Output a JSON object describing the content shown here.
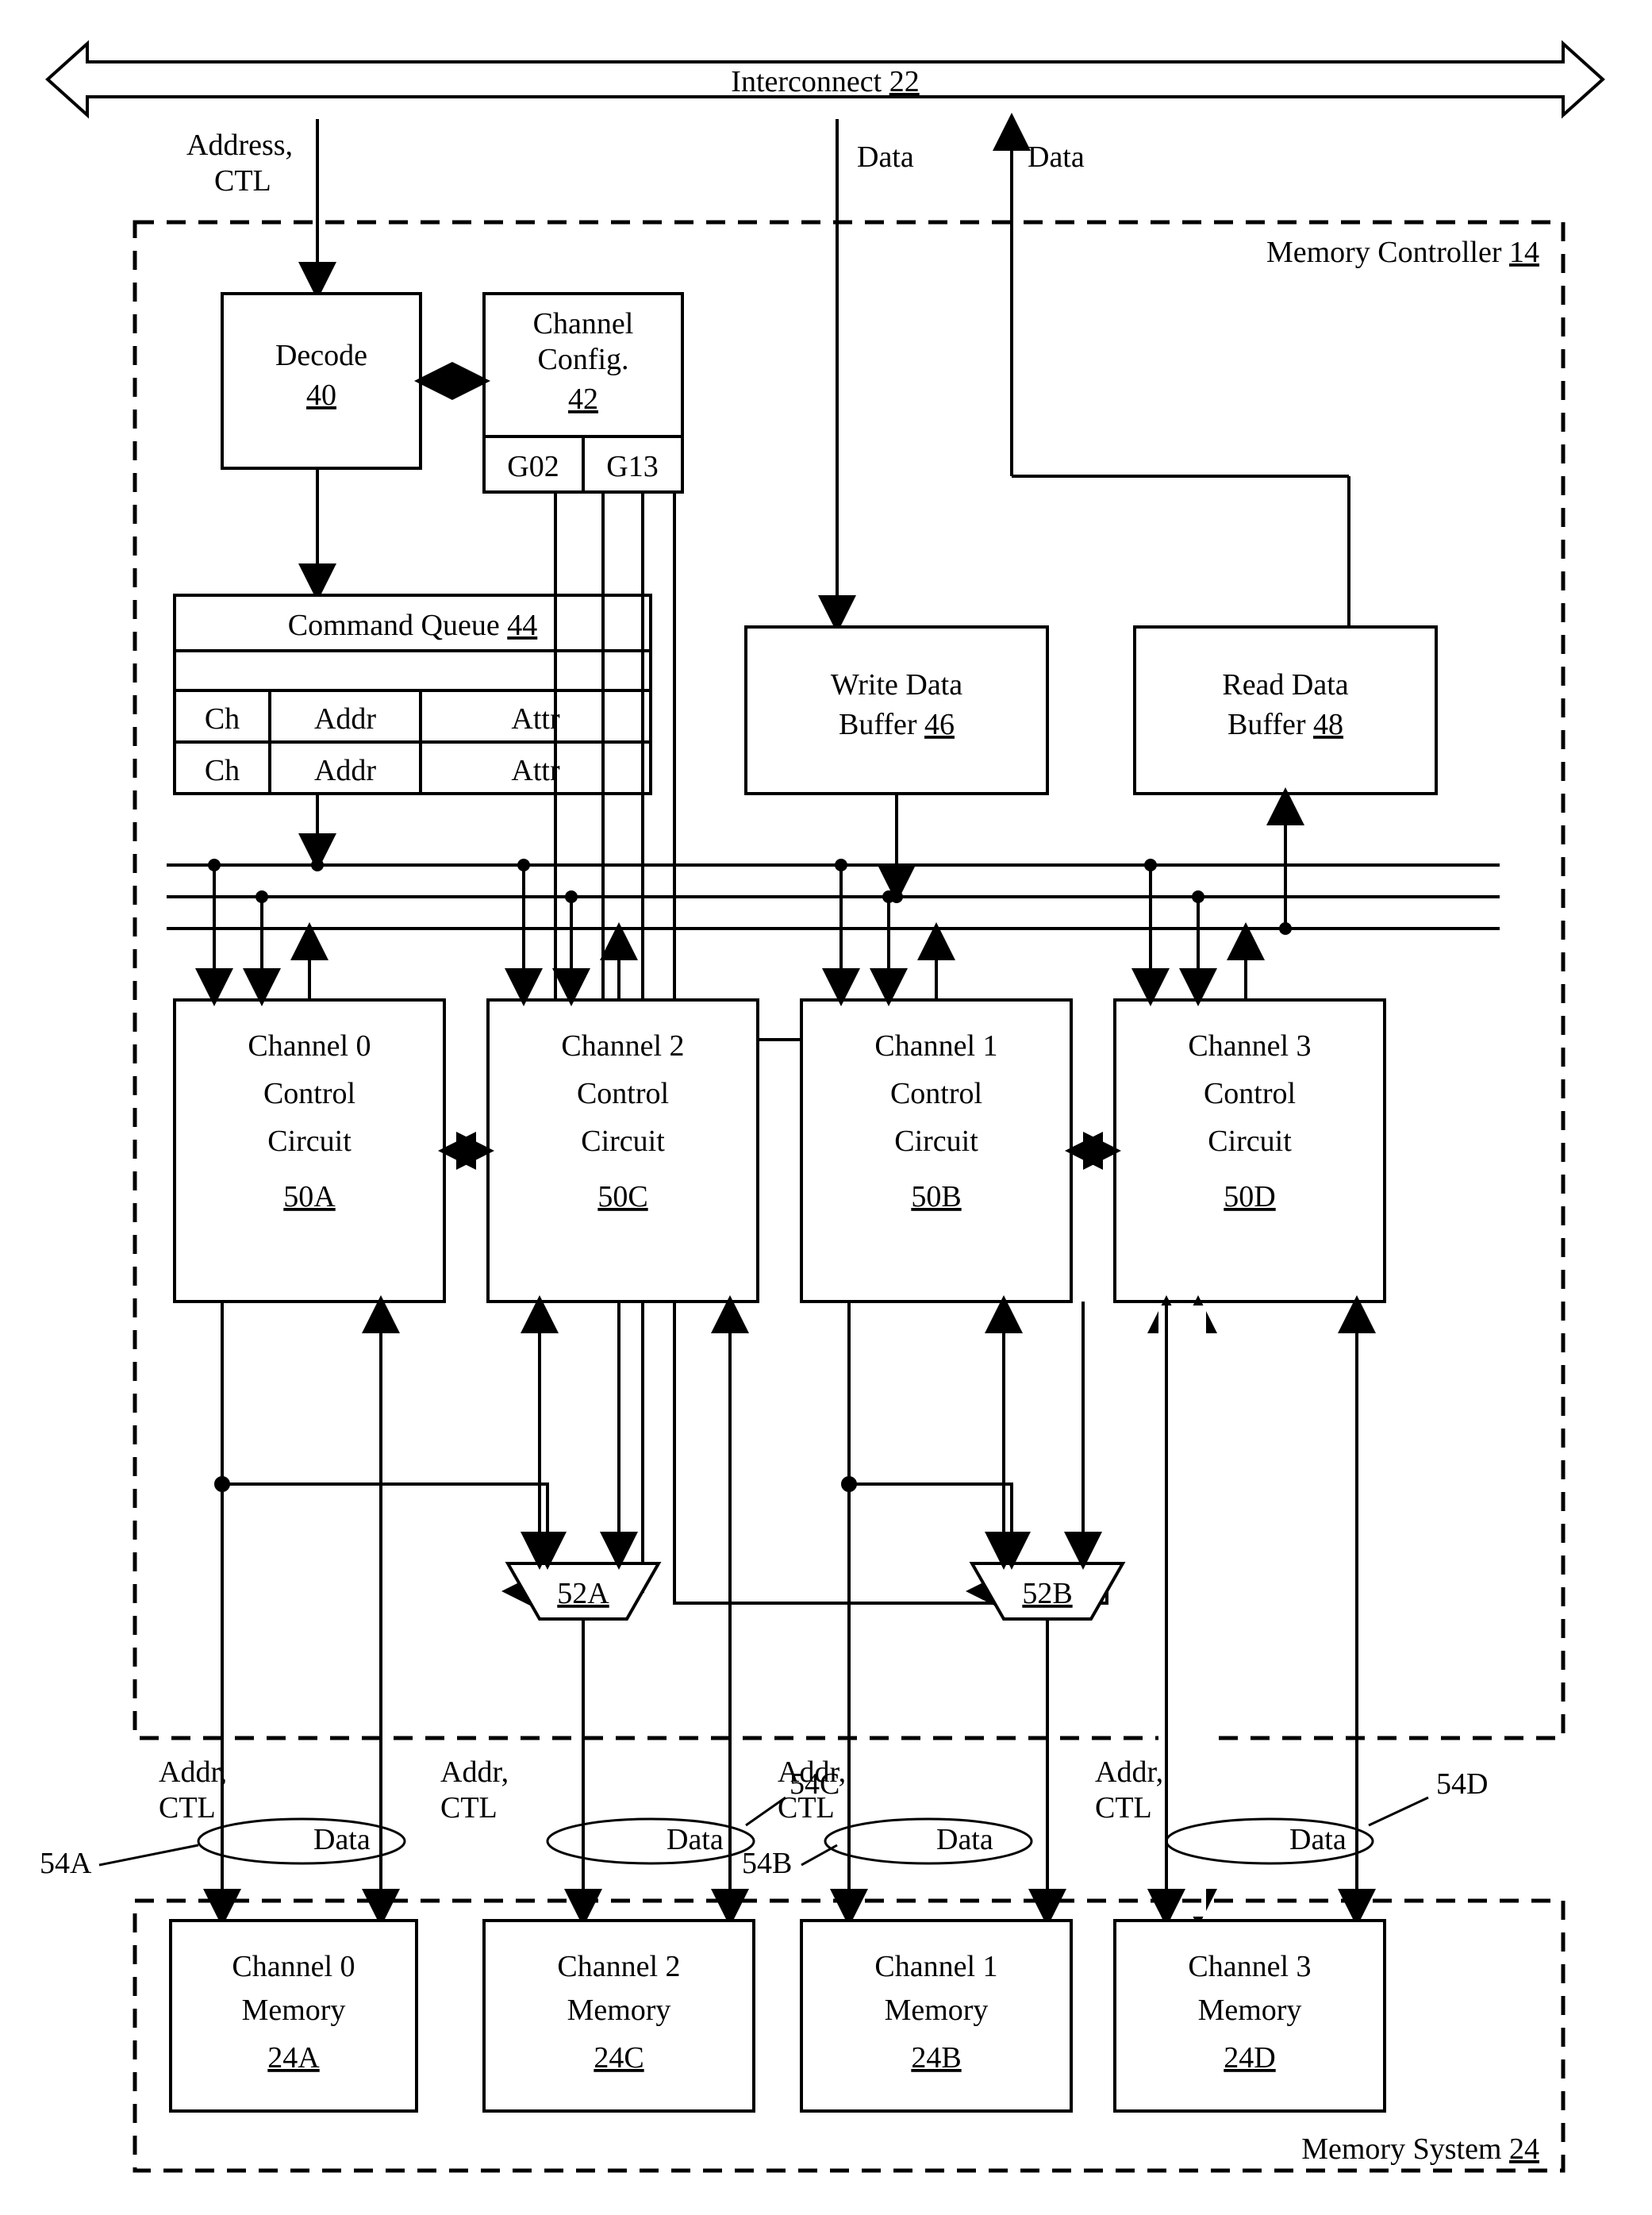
{
  "interconnect": {
    "label": "Interconnect",
    "ref": "22"
  },
  "external": {
    "addr_ctl": "Address,",
    "addr_ctl2": "CTL",
    "data_down": "Data",
    "data_up": "Data"
  },
  "mc": {
    "label": "Memory Controller",
    "ref": "14"
  },
  "decode": {
    "label": "Decode",
    "ref": "40"
  },
  "cfg": {
    "label": "Channel",
    "label2": "Config.",
    "ref": "42",
    "g02": "G02",
    "g13": "G13"
  },
  "cq": {
    "label": "Command Queue",
    "ref": "44",
    "h1": "Ch",
    "h2": "Addr",
    "h3": "Attr"
  },
  "wbuf": {
    "label": "Write Data",
    "label2": "Buffer",
    "ref": "46"
  },
  "rbuf": {
    "label": "Read Data",
    "label2": "Buffer",
    "ref": "48"
  },
  "ch0": {
    "l1": "Channel 0",
    "l2": "Control",
    "l3": "Circuit",
    "ref": "50A"
  },
  "ch2": {
    "l1": "Channel 2",
    "l2": "Control",
    "l3": "Circuit",
    "ref": "50C"
  },
  "ch1": {
    "l1": "Channel 1",
    "l2": "Control",
    "l3": "Circuit",
    "ref": "50B"
  },
  "ch3": {
    "l1": "Channel 3",
    "l2": "Control",
    "l3": "Circuit",
    "ref": "50D"
  },
  "muxA": {
    "ref": "52A"
  },
  "muxB": {
    "ref": "52B"
  },
  "bus": {
    "addr_ctl1": "Addr,",
    "addr_ctl2": "CTL",
    "data": "Data",
    "a": "54A",
    "b": "54B",
    "c": "54C",
    "d": "54D"
  },
  "mem0": {
    "l1": "Channel 0",
    "l2": "Memory",
    "ref": "24A"
  },
  "mem2": {
    "l1": "Channel 2",
    "l2": "Memory",
    "ref": "24C"
  },
  "mem1": {
    "l1": "Channel 1",
    "l2": "Memory",
    "ref": "24B"
  },
  "mem3": {
    "l1": "Channel 3",
    "l2": "Memory",
    "ref": "24D"
  },
  "ms": {
    "label": "Memory System",
    "ref": "24"
  }
}
